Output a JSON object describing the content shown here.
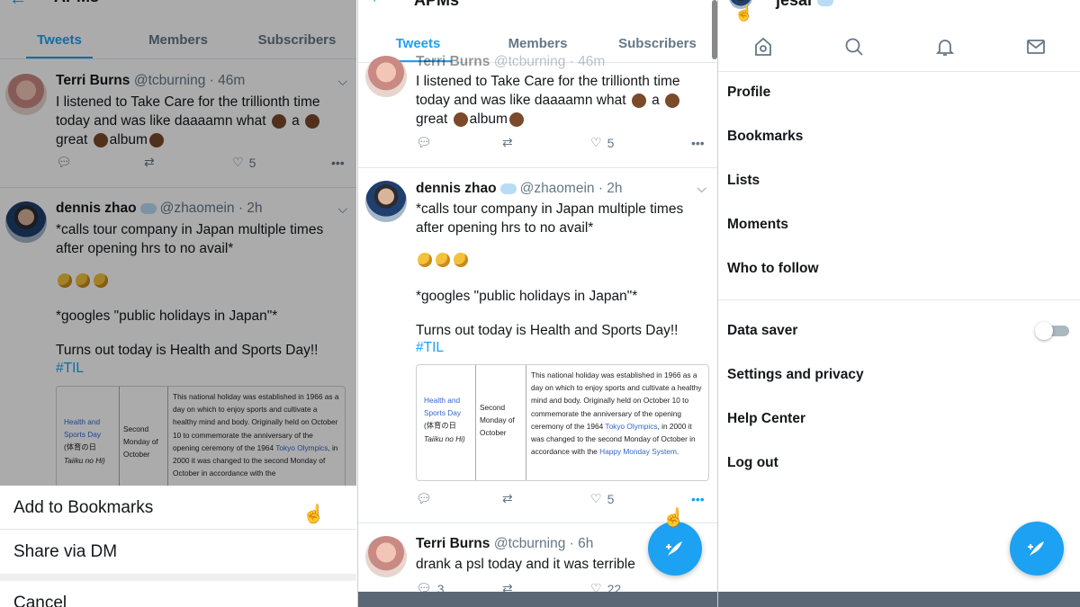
{
  "list_title": "APMs",
  "tabs": [
    "Tweets",
    "Members",
    "Subscribers"
  ],
  "tweets": {
    "terri": {
      "name": "Terri Burns",
      "handle": "@tcburning · 46m",
      "handle_p2": "@tcburning · 46m",
      "text_a": "I listened to Take Care for the trillionth time today and was like daaaamn what",
      "text_b": "a",
      "text_c": "great",
      "text_d": "album",
      "likes": "5"
    },
    "dennis": {
      "name": "dennis zhao",
      "handle": "@zhaomein · 2h",
      "text_1": "*calls tour company in Japan multiple times after opening hrs to no avail*",
      "text_2": "*googles \"public holidays in Japan\"*",
      "text_3": "Turns out today is Health and Sports Day!!",
      "hashtag": "#TIL",
      "likes": "5"
    },
    "terri2": {
      "name": "Terri Burns",
      "handle": "@tcburning · 6h",
      "text": "drank a psl today and it was terrible",
      "replies": "3",
      "likes": "22"
    }
  },
  "wiki_card": {
    "holiday_name": "Health and Sports Day",
    "holiday_japanese": "(体育の日",
    "holiday_romaji": "Taiiku no Hi)",
    "date": "Second Monday of October",
    "desc_1": "This national holiday was established in 1966 as a day on which to enjoy sports and cultivate a healthy mind and body. Originally held on October 10 to commemorate the anniversary of the opening ceremony of the 1964",
    "desc_link1": "Tokyo Olympics",
    "desc_2": ", in 2000 it was changed to the second Monday of October in accordance with the",
    "desc_link2": "Happy Monday System",
    "desc_3": ".",
    "desc_short": "..., in 2000 it was changed to the second Monday of October in"
  },
  "action_sheet": [
    "Add to Bookmarks",
    "Share via DM",
    "Cancel"
  ],
  "drawer": {
    "username": "jesar",
    "menu_primary": [
      "Profile",
      "Bookmarks",
      "Lists",
      "Moments",
      "Who to follow"
    ],
    "data_saver": "Data saver",
    "data_saver_on": false,
    "menu_secondary": [
      "Settings and privacy",
      "Help Center",
      "Log out"
    ]
  },
  "colors": {
    "accent": "#1da1f2",
    "text": "#14171a",
    "muted": "#657786"
  },
  "icons": [
    "back-arrow-icon",
    "reply-icon",
    "retweet-icon",
    "like-icon",
    "more-icon",
    "chevron-down-icon",
    "compose-icon",
    "home-icon",
    "search-icon",
    "bell-icon",
    "mail-icon",
    "hand-cursor-icon"
  ]
}
